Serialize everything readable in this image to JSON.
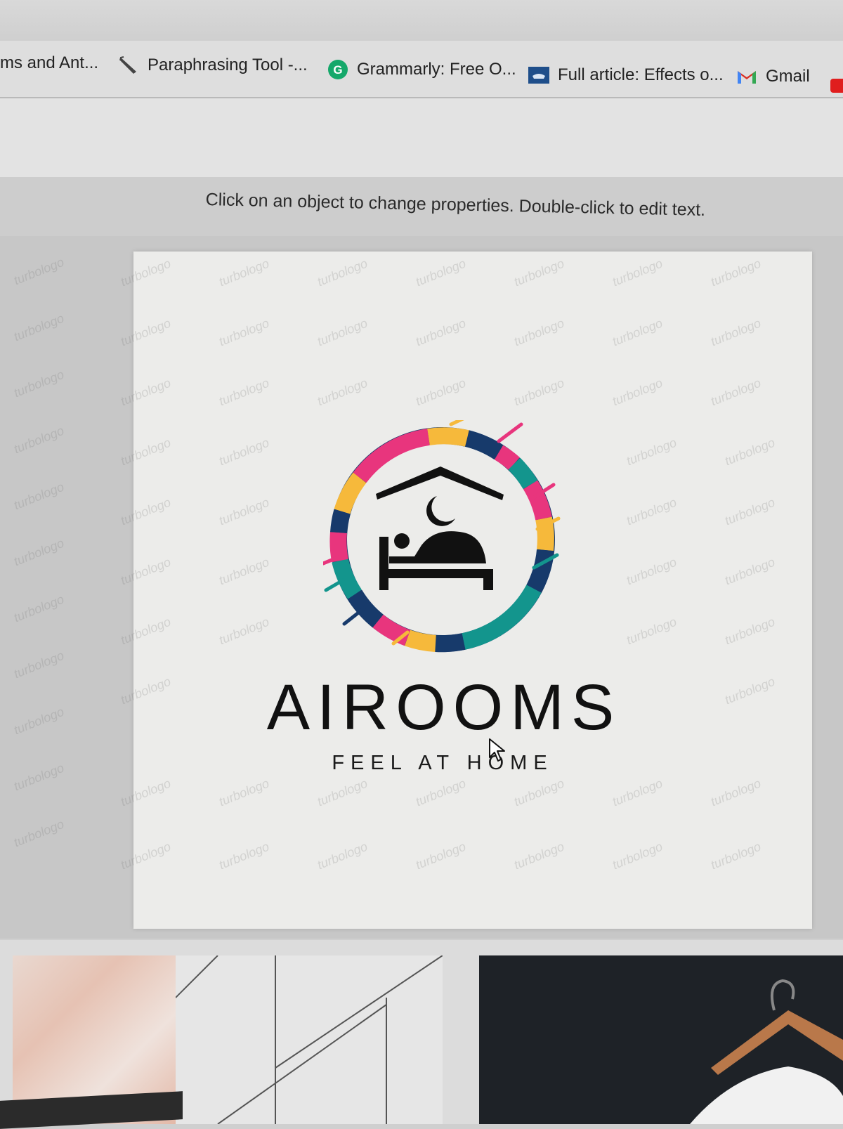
{
  "bookmarks": [
    {
      "label": "ms and Ant...",
      "icon": "none"
    },
    {
      "label": "Paraphrasing Tool -...",
      "icon": "quill-icon"
    },
    {
      "label": "Grammarly: Free O...",
      "icon": "grammarly-icon"
    },
    {
      "label": "Full article: Effects o...",
      "icon": "article-icon"
    },
    {
      "label": "Gmail",
      "icon": "gmail-icon"
    }
  ],
  "editor": {
    "hint": "Click on an object to change properties. Double-click to edit text.",
    "watermark": "turbologo"
  },
  "logo": {
    "brand": "AIROOMS",
    "tagline": "FEEL AT HOME",
    "colors": {
      "pink": "#e8357d",
      "yellow": "#f6b93b",
      "navy": "#173a6b",
      "teal": "#13958d",
      "ink": "#111111"
    }
  }
}
